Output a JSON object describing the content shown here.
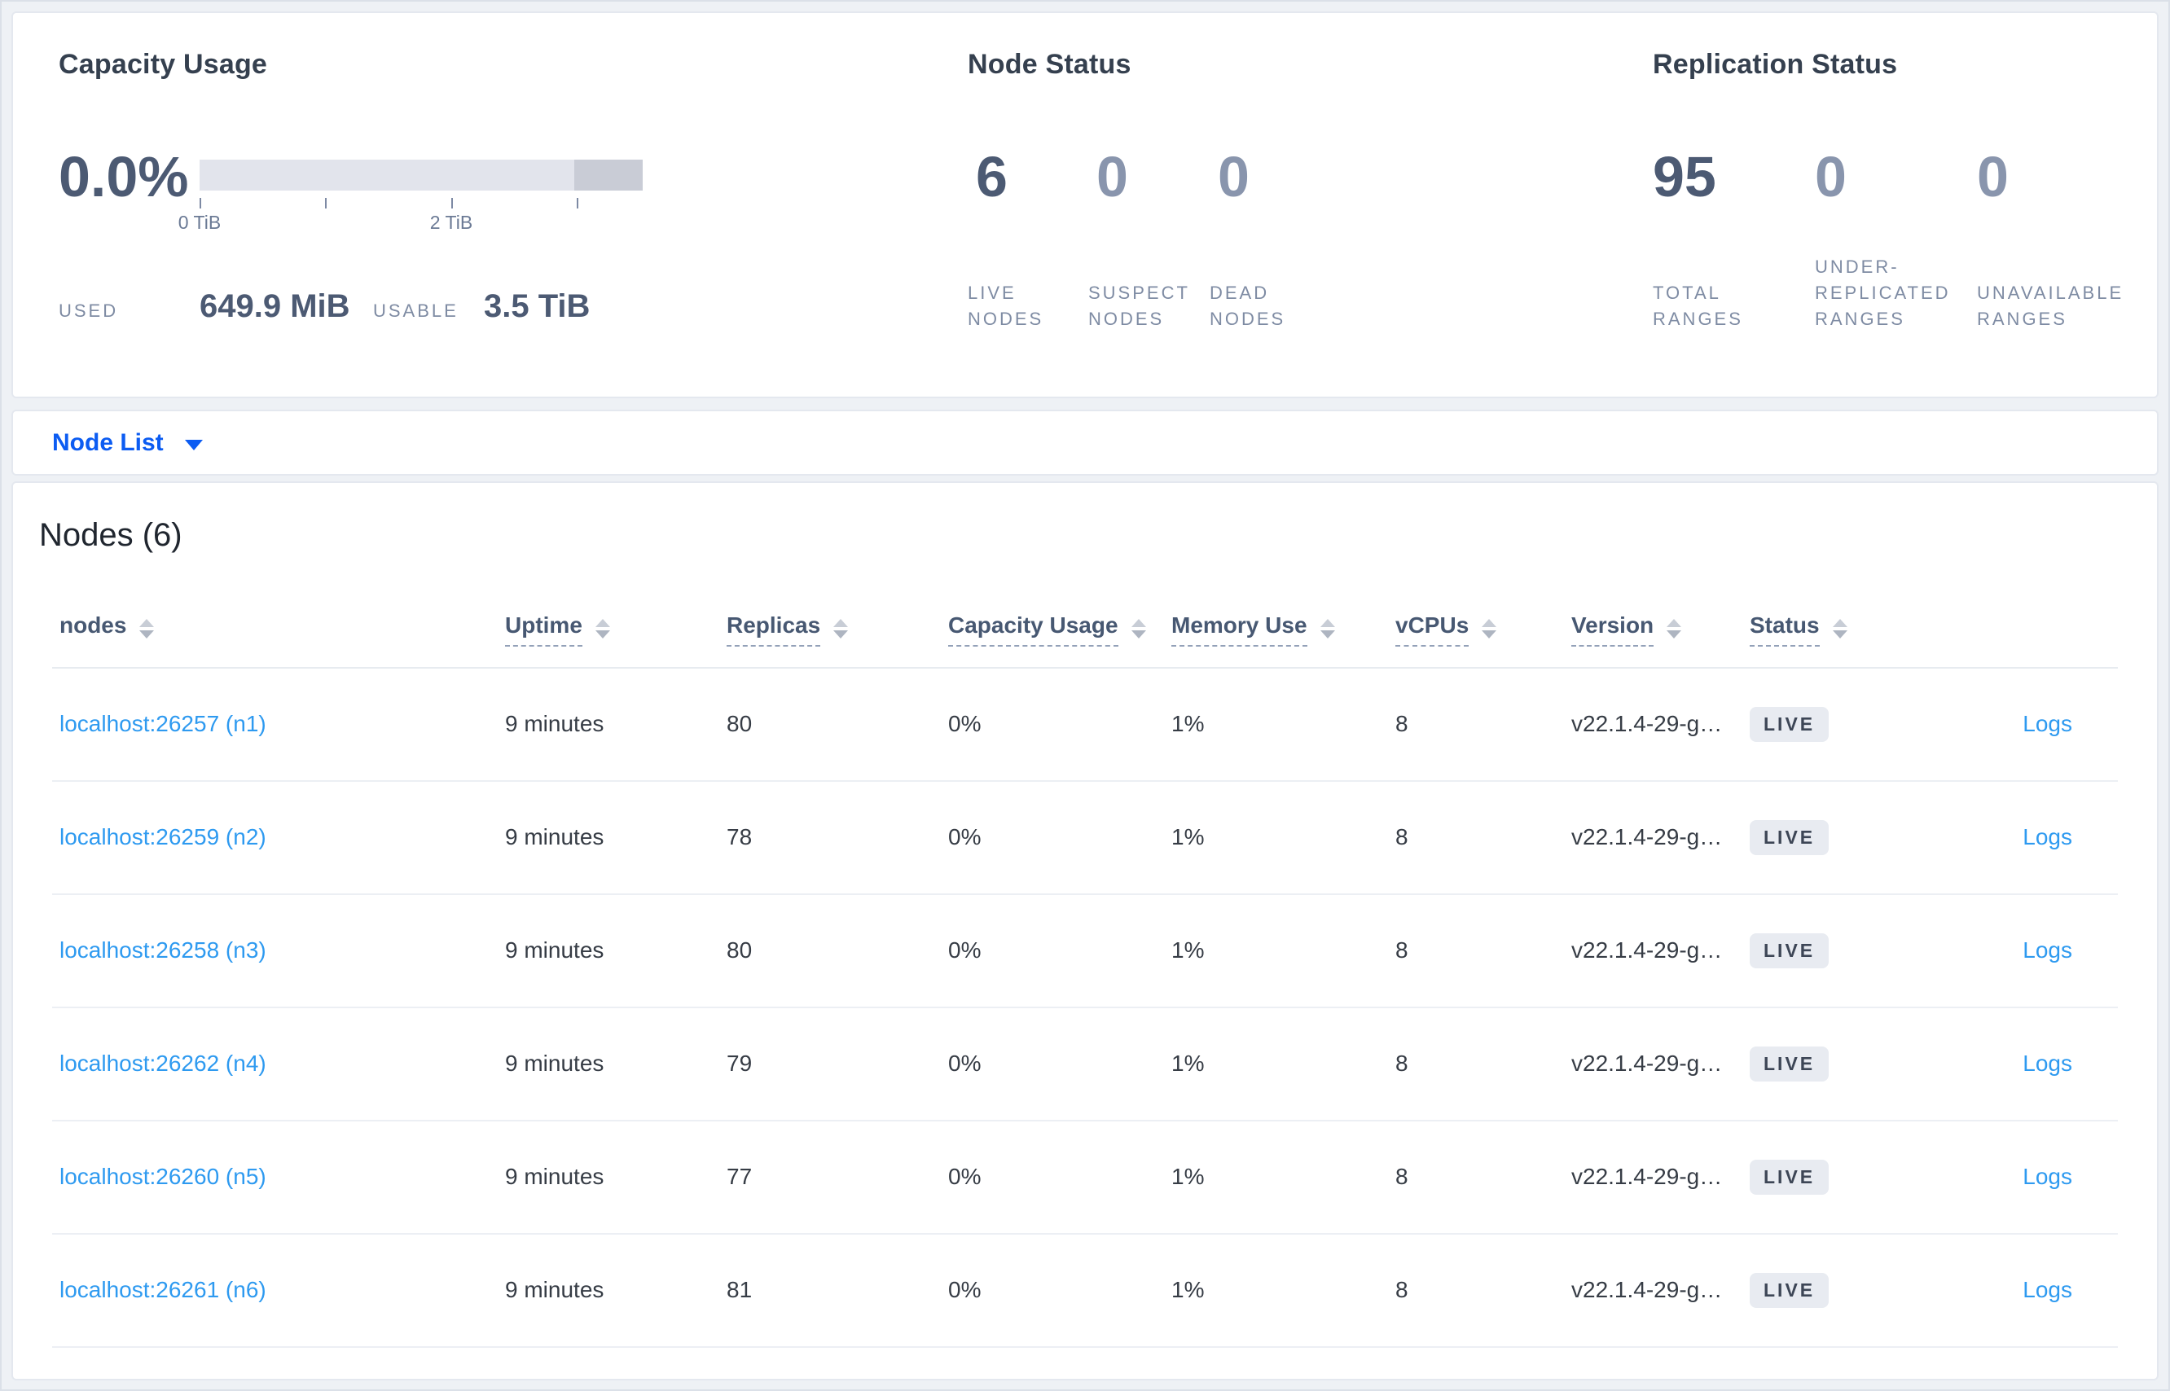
{
  "colors": {
    "accent_blue": "#0c5cf2",
    "link_blue": "#2e9af0",
    "live_badge_bg": "#e8ebf1",
    "live_badge_text": "#3d4656",
    "capacity_bar_track": "#e2e4ec",
    "capacity_bar_dark": "#c9ccd6"
  },
  "summary": {
    "capacity": {
      "title": "Capacity Usage",
      "percent": "0.0%",
      "tick_labels": [
        "0 TiB",
        "2 TiB"
      ],
      "used_label": "USED",
      "used_value": "649.9 MiB",
      "usable_label": "USABLE",
      "usable_value": "3.5 TiB"
    },
    "node_status": {
      "title": "Node Status",
      "stats": [
        {
          "value": "6",
          "label": "LIVE NODES"
        },
        {
          "value": "0",
          "label": "SUSPECT NODES"
        },
        {
          "value": "0",
          "label": "DEAD NODES"
        }
      ]
    },
    "replication_status": {
      "title": "Replication Status",
      "stats": [
        {
          "value": "95",
          "label": "TOTAL RANGES"
        },
        {
          "value": "0",
          "label": "UNDER-REPLICATED RANGES"
        },
        {
          "value": "0",
          "label": "UNAVAILABLE RANGES"
        }
      ]
    }
  },
  "view_selector": {
    "label": "Node List"
  },
  "nodes_table": {
    "title": "Nodes (6)",
    "columns": [
      "nodes",
      "Uptime",
      "Replicas",
      "Capacity Usage",
      "Memory Use",
      "vCPUs",
      "Version",
      "Status"
    ],
    "logs_label": "Logs",
    "rows": [
      {
        "node": "localhost:26257 (n1)",
        "uptime": "9 minutes",
        "replicas": "80",
        "capacity": "0%",
        "memory": "1%",
        "vcpus": "8",
        "version": "v22.1.4-29-g…",
        "status": "LIVE"
      },
      {
        "node": "localhost:26259 (n2)",
        "uptime": "9 minutes",
        "replicas": "78",
        "capacity": "0%",
        "memory": "1%",
        "vcpus": "8",
        "version": "v22.1.4-29-g…",
        "status": "LIVE"
      },
      {
        "node": "localhost:26258 (n3)",
        "uptime": "9 minutes",
        "replicas": "80",
        "capacity": "0%",
        "memory": "1%",
        "vcpus": "8",
        "version": "v22.1.4-29-g…",
        "status": "LIVE"
      },
      {
        "node": "localhost:26262 (n4)",
        "uptime": "9 minutes",
        "replicas": "79",
        "capacity": "0%",
        "memory": "1%",
        "vcpus": "8",
        "version": "v22.1.4-29-g…",
        "status": "LIVE"
      },
      {
        "node": "localhost:26260 (n5)",
        "uptime": "9 minutes",
        "replicas": "77",
        "capacity": "0%",
        "memory": "1%",
        "vcpus": "8",
        "version": "v22.1.4-29-g…",
        "status": "LIVE"
      },
      {
        "node": "localhost:26261 (n6)",
        "uptime": "9 minutes",
        "replicas": "81",
        "capacity": "0%",
        "memory": "1%",
        "vcpus": "8",
        "version": "v22.1.4-29-g…",
        "status": "LIVE"
      }
    ]
  }
}
